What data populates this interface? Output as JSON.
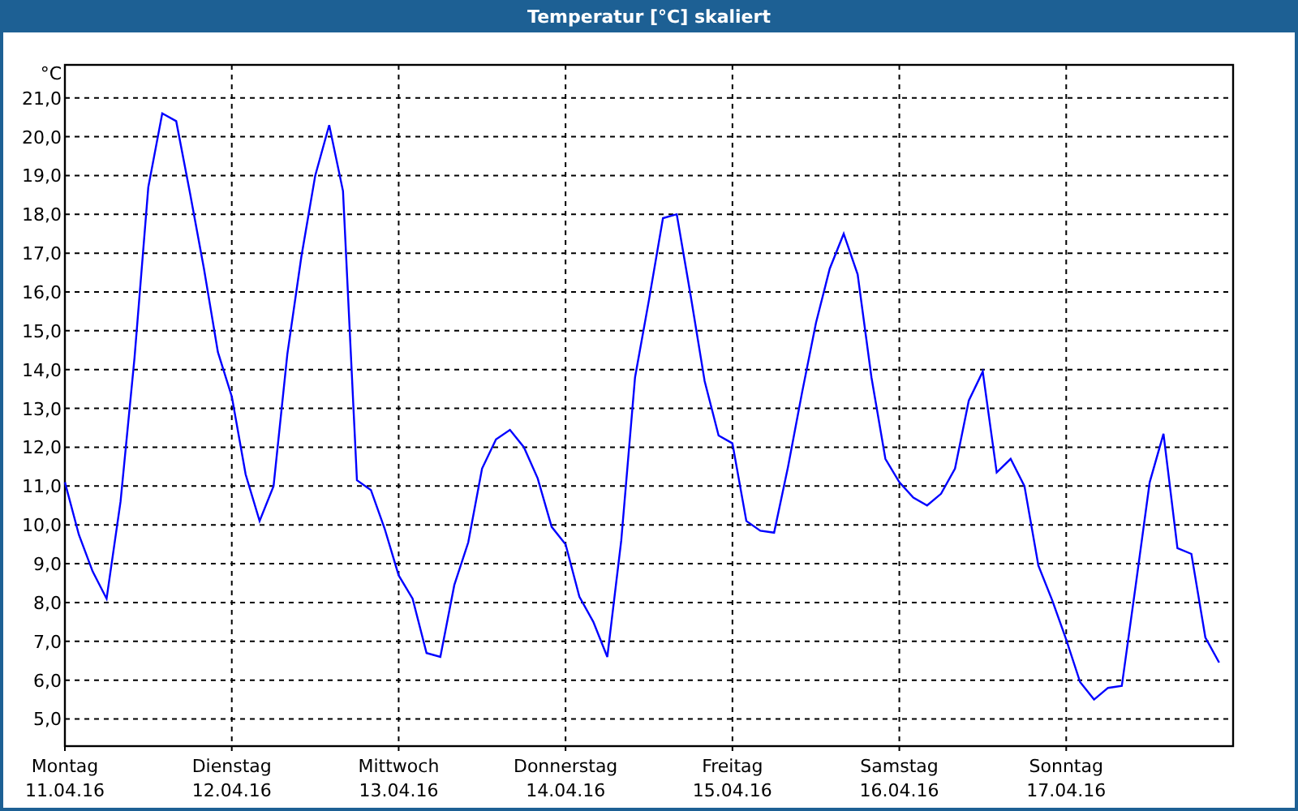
{
  "chart_data": {
    "type": "line",
    "title": "Temperatur [°C] skaliert",
    "ylabel": "°C",
    "categories": [
      "11.04.16",
      null,
      null,
      null,
      null,
      null,
      null,
      null,
      null,
      null,
      null,
      null,
      "12.04.16",
      null,
      null,
      null,
      null,
      null,
      null,
      null,
      null,
      null,
      null,
      null,
      "13.04.16",
      null,
      null,
      null,
      null,
      null,
      null,
      null,
      null,
      null,
      null,
      null,
      "14.04.16",
      null,
      null,
      null,
      null,
      null,
      null,
      null,
      null,
      null,
      null,
      null,
      "15.04.16",
      null,
      null,
      null,
      null,
      null,
      null,
      null,
      null,
      null,
      null,
      null,
      "16.04.16",
      null,
      null,
      null,
      null,
      null,
      null,
      null,
      null,
      null,
      null,
      null,
      "17.04.16",
      null,
      null,
      null,
      null,
      null,
      null,
      null,
      null,
      null,
      null,
      null
    ],
    "series": [
      {
        "color": "#0000ff",
        "values": [
          11.1,
          9.75,
          8.8,
          8.1,
          10.6,
          14.3,
          18.7,
          20.6,
          20.4,
          18.55,
          16.6,
          14.45,
          13.3,
          11.3,
          10.1,
          11.0,
          14.4,
          16.9,
          19.0,
          20.3,
          18.6,
          11.15,
          10.9,
          9.9,
          8.7,
          8.1,
          6.7,
          6.6,
          8.45,
          9.55,
          11.45,
          12.2,
          12.45,
          12.0,
          11.2,
          9.95,
          9.5,
          8.15,
          7.5,
          6.6,
          9.6,
          13.8,
          15.8,
          17.9,
          18.0,
          15.9,
          13.7,
          12.3,
          12.1,
          10.1,
          9.85,
          9.8,
          11.5,
          13.4,
          15.2,
          16.6,
          17.5,
          16.45,
          13.8,
          11.7,
          11.1,
          10.7,
          10.5,
          10.8,
          11.45,
          13.2,
          13.95,
          11.35,
          11.7,
          11.0,
          8.95,
          8.05,
          7.05,
          5.95,
          5.5,
          5.8,
          5.85,
          8.45,
          11.1,
          12.35,
          9.4,
          9.25,
          7.1,
          6.45
        ]
      }
    ],
    "grid": true,
    "ylim": [
      4.3,
      21.85
    ],
    "yticks": [
      {
        "value": 5,
        "label": "5,0"
      },
      {
        "value": 6,
        "label": "6,0"
      },
      {
        "value": 7,
        "label": "7,0"
      },
      {
        "value": 8,
        "label": "8,0"
      },
      {
        "value": 9,
        "label": "9,0"
      },
      {
        "value": 10,
        "label": "10,0"
      },
      {
        "value": 11,
        "label": "11,0"
      },
      {
        "value": 12,
        "label": "12,0"
      },
      {
        "value": 13,
        "label": "13,0"
      },
      {
        "value": 14,
        "label": "14,0"
      },
      {
        "value": 15,
        "label": "15,0"
      },
      {
        "value": 16,
        "label": "16,0"
      },
      {
        "value": 17,
        "label": "17,0"
      },
      {
        "value": 18,
        "label": "18,0"
      },
      {
        "value": 19,
        "label": "19,0"
      },
      {
        "value": 20,
        "label": "20,0"
      },
      {
        "value": 21,
        "label": "21,0"
      }
    ]
  },
  "weekday_labels": [
    "Montag",
    "Dienstag",
    "Mittwoch",
    "Donnerstag",
    "Freitag",
    "Samstag",
    "Sonntag"
  ]
}
